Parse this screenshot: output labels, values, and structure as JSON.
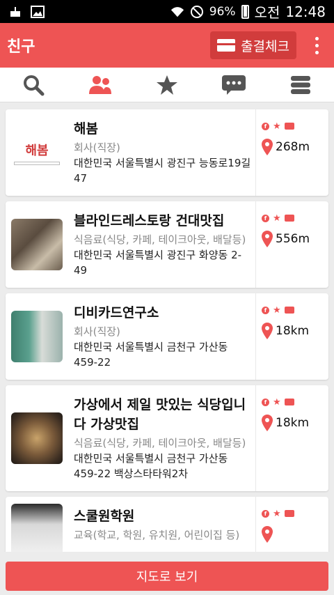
{
  "status": {
    "battery": "96%",
    "ampm": "오전",
    "time": "12:48"
  },
  "appbar": {
    "title": "친구",
    "checkin_label": "출결체크"
  },
  "tabs": [
    {
      "name": "search",
      "icon": "search-icon"
    },
    {
      "name": "friends",
      "icon": "people-icon",
      "active": true
    },
    {
      "name": "favorites",
      "icon": "star-icon"
    },
    {
      "name": "messages",
      "icon": "chat-icon"
    },
    {
      "name": "menu",
      "icon": "list-icon"
    }
  ],
  "places": [
    {
      "name": "해봄",
      "category": "회사(직장)",
      "address": "대한민국 서울특별시 광진구 능동로19길 47",
      "distance": "268m",
      "logo_text": "해봄"
    },
    {
      "name": "블라인드레스토랑 건대맛집",
      "category": "식음료(식당, 카페, 테이크아웃, 배달등)",
      "address": "대한민국 서울특별시 광진구 화양동 2-49",
      "distance": "556m"
    },
    {
      "name": "디비카드연구소",
      "category": "회사(직장)",
      "address": "대한민국 서울특별시 금천구 가산동 459-22",
      "distance": "18km"
    },
    {
      "name": "가상에서 제일 맛있는 식당입니다 가상맛집",
      "category": "식음료(식당, 카페, 테이크아웃, 배달등)",
      "address": "대한민국 서울특별시 금천구 가산동 459-22 백상스타타워2차",
      "distance": "18km"
    },
    {
      "name": "스쿨원학원",
      "category": "교육(학교, 학원, 유치원, 어린이집 등)",
      "address": "",
      "distance": ""
    }
  ],
  "colors": {
    "accent": "#ee5454",
    "accent_dark": "#d13c3c"
  },
  "bottom_button": "지도로 보기"
}
